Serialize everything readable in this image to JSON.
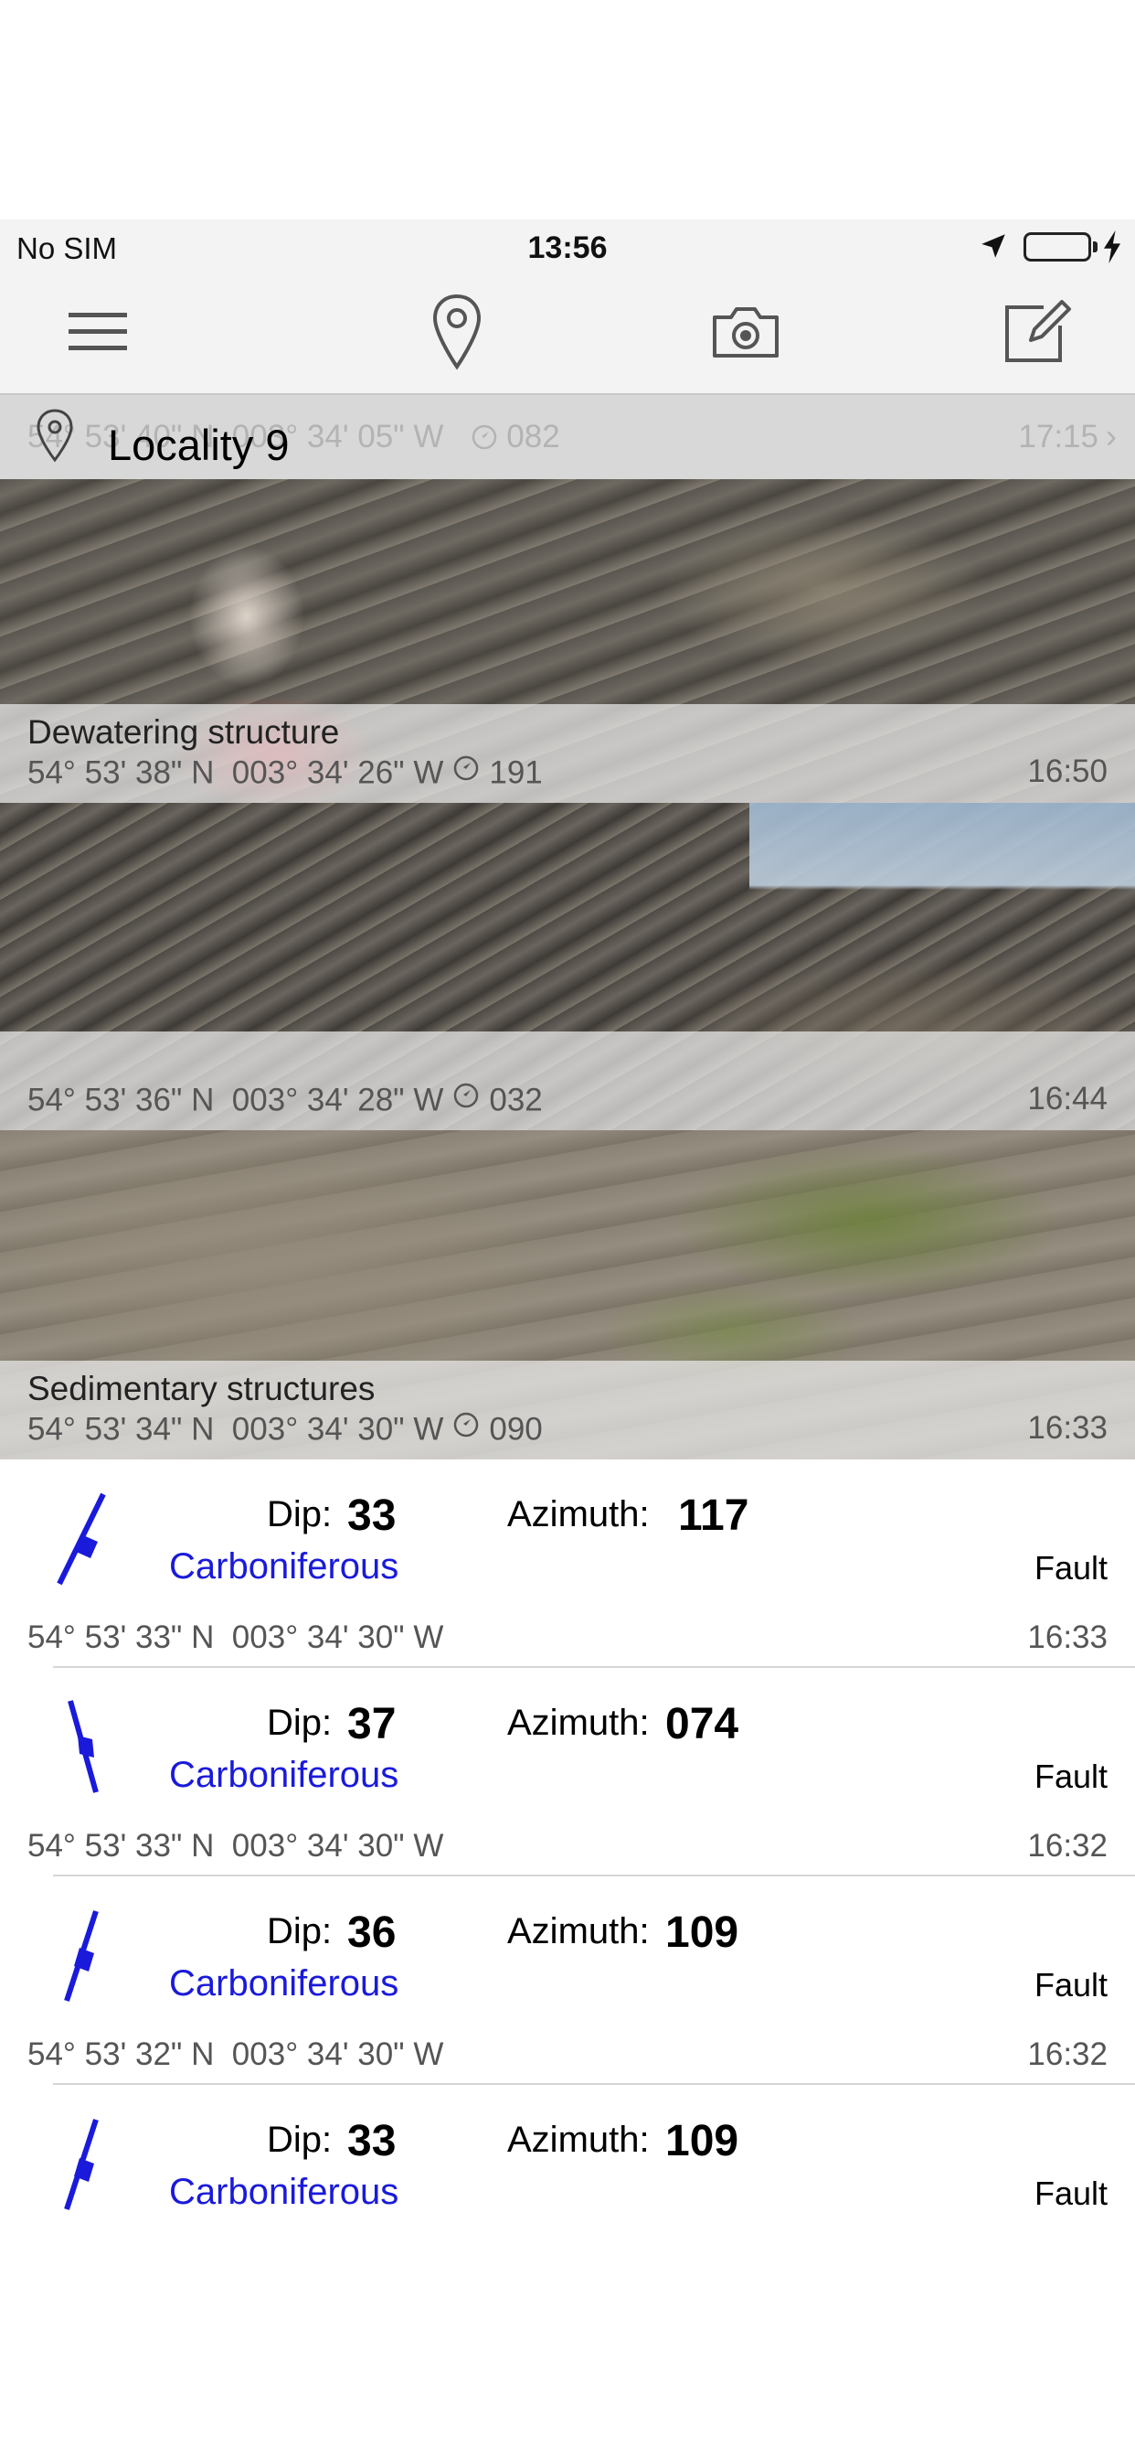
{
  "status_bar": {
    "carrier": "No SIM",
    "time": "13:56",
    "battery_color": "#4cd964"
  },
  "toolbar": {
    "icons": [
      "menu-icon",
      "map-pin-icon",
      "camera-icon",
      "compose-icon"
    ]
  },
  "locality": {
    "title": "Locality 9",
    "ghost_coords": "54° 53' 40\" N  003° 34' 05\" W",
    "ghost_bearing": "082",
    "ghost_time": "17:15"
  },
  "photos": [
    {
      "title": "Dewatering structure",
      "lat": "54° 53' 38\" N",
      "lon": "003° 34' 26\" W",
      "bearing": "191",
      "time": "16:50"
    },
    {
      "title": "",
      "lat": "54° 53' 36\" N",
      "lon": "003° 34' 28\" W",
      "bearing": "032",
      "time": "16:44"
    },
    {
      "title": "Sedimentary structures",
      "lat": "54° 53' 34\" N",
      "lon": "003° 34' 30\" W",
      "bearing": "090",
      "time": "16:33"
    }
  ],
  "measurements": [
    {
      "dip_label": "Dip:",
      "dip": "33",
      "azimuth_label": "Azimuth:",
      "azimuth": "117",
      "era": "Carboniferous",
      "kind": "Fault",
      "lat": "54° 53' 33\" N",
      "lon": "003° 34' 30\" W",
      "time": "16:33"
    },
    {
      "dip_label": "Dip:",
      "dip": "37",
      "azimuth_label": "Azimuth:",
      "azimuth": "074",
      "era": "Carboniferous",
      "kind": "Fault",
      "lat": "54° 53' 33\" N",
      "lon": "003° 34' 30\" W",
      "time": "16:32"
    },
    {
      "dip_label": "Dip:",
      "dip": "36",
      "azimuth_label": "Azimuth:",
      "azimuth": "109",
      "era": "Carboniferous",
      "kind": "Fault",
      "lat": "54° 53' 32\" N",
      "lon": "003° 34' 30\" W",
      "time": "16:32"
    },
    {
      "dip_label": "Dip:",
      "dip": "33",
      "azimuth_label": "Azimuth:",
      "azimuth": "109",
      "era": "Carboniferous",
      "kind": "Fault",
      "lat": "",
      "lon": "",
      "time": ""
    }
  ],
  "colors": {
    "era_text": "#1a1adb",
    "symbol": "#1a1adb",
    "bar_background": "#f3f3f3"
  }
}
